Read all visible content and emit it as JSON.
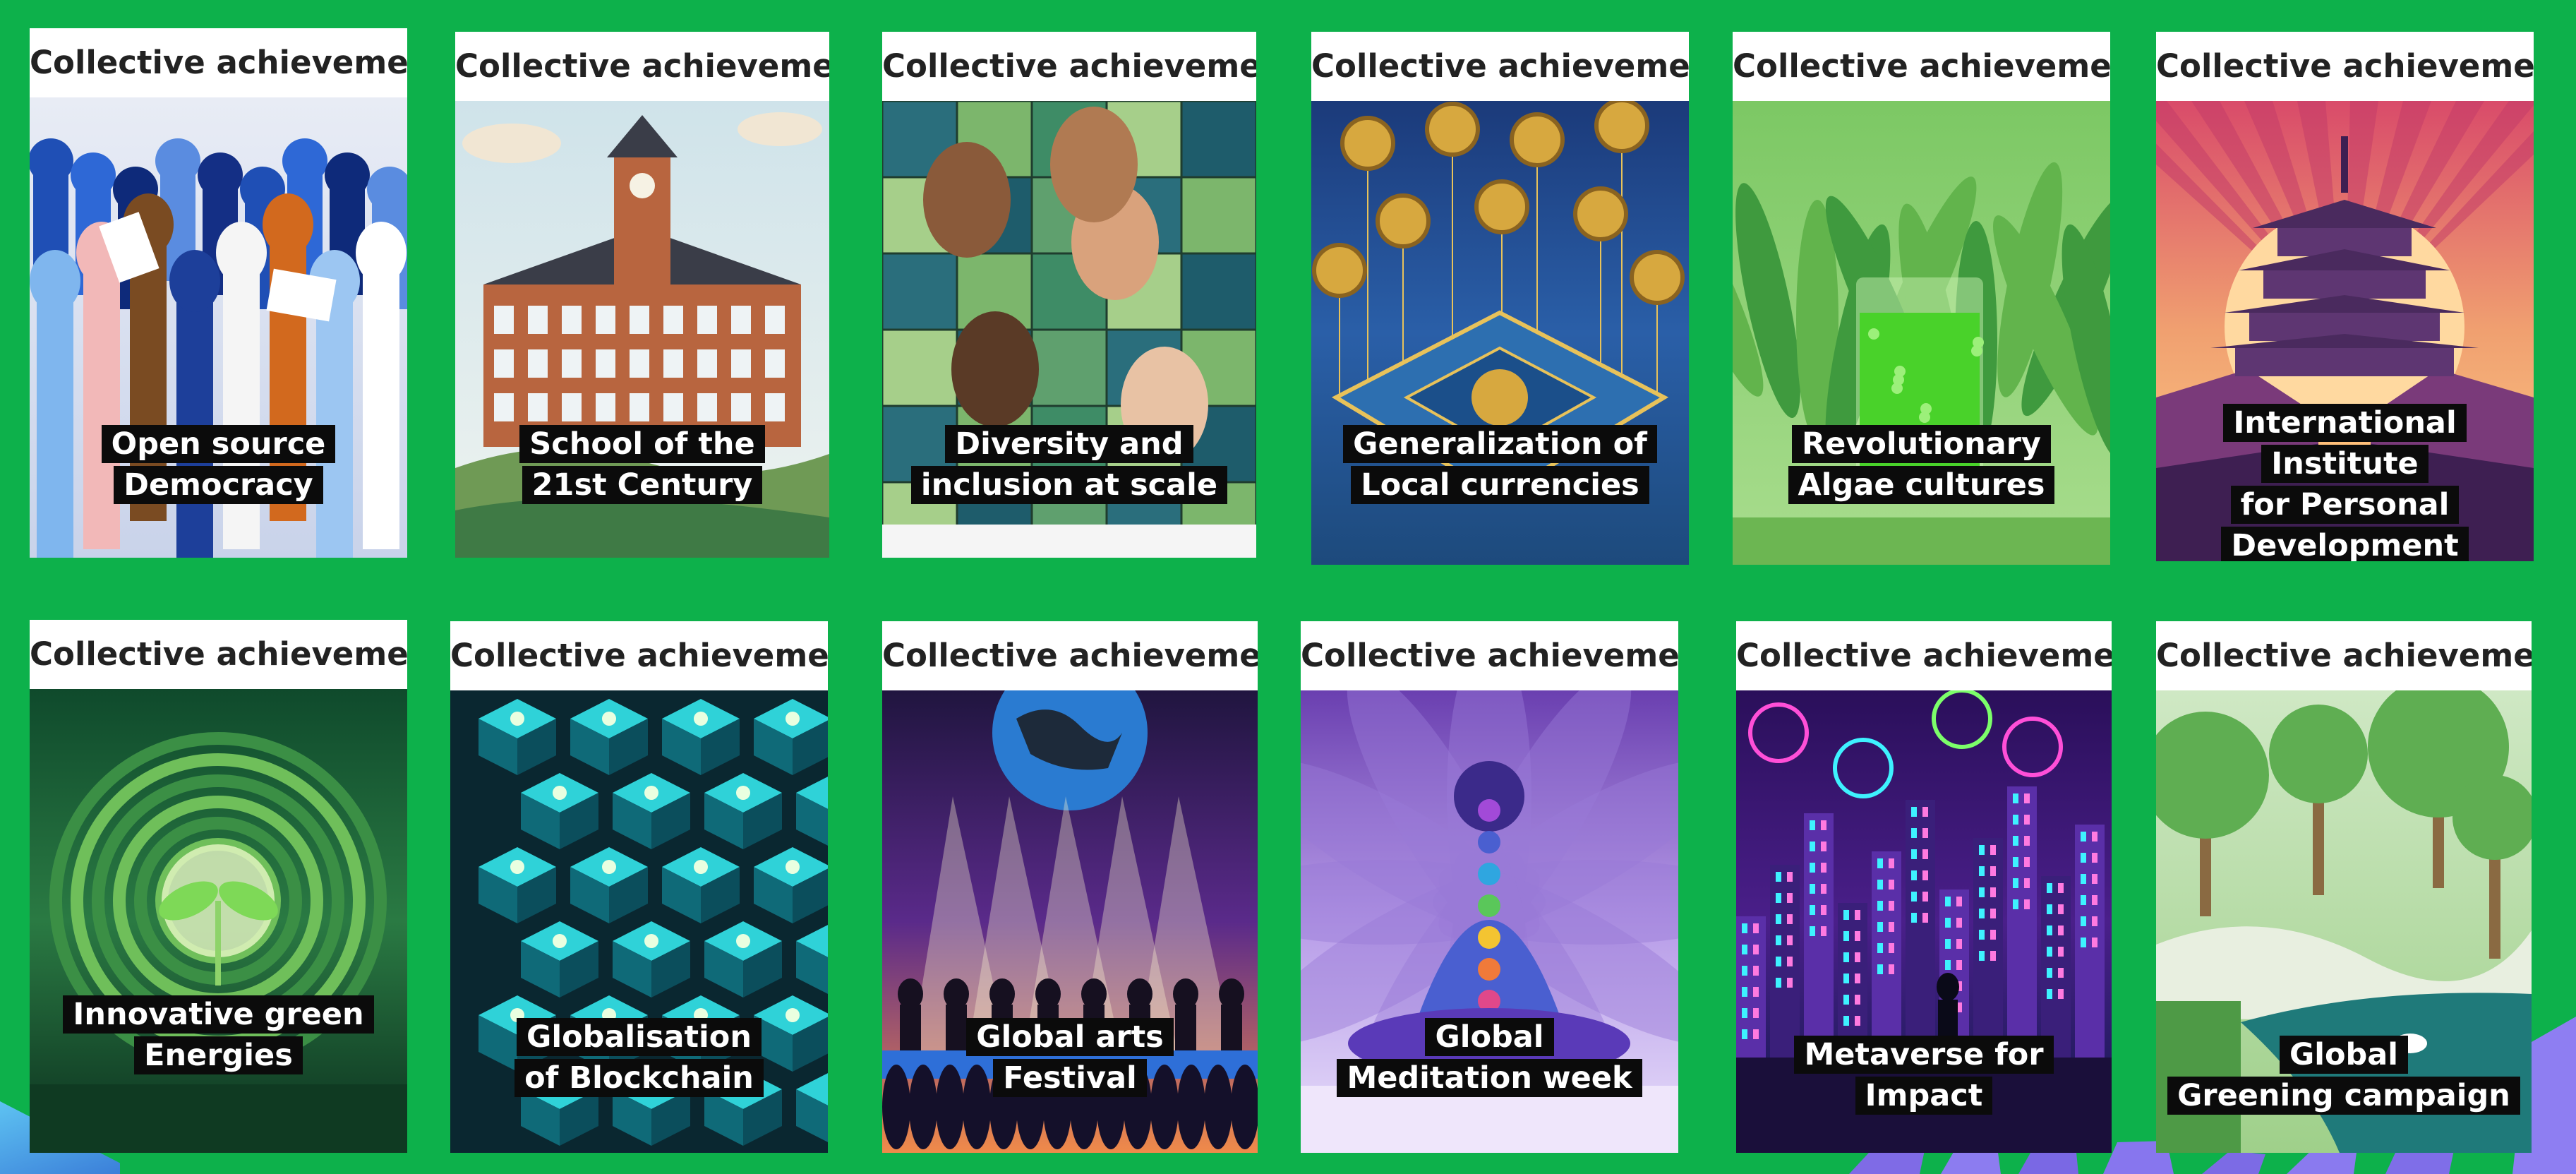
{
  "cards": [
    {
      "header": "Collective achievements",
      "caption": "Open source\nDemocracy",
      "art": "raised-hands-illustration"
    },
    {
      "header": "Collective achievements",
      "caption": "School of the\n21st Century",
      "art": "brick-school-building-illustration"
    },
    {
      "header": "Collective achievements",
      "caption": "Diversity and\ninclusion at scale",
      "art": "puzzle-faces-illustration"
    },
    {
      "header": "Collective achievements",
      "caption": "Generalization of\nLocal currencies",
      "art": "coin-circuit-chip-illustration"
    },
    {
      "header": "Collective achievements",
      "caption": "Revolutionary\nAlgae cultures",
      "art": "green-algae-glass-illustration"
    },
    {
      "header": "Collective achievements",
      "caption": "International Institute\nfor Personal\nDevelopment",
      "art": "pagoda-sunset-illustration"
    },
    {
      "header": "Collective achievements",
      "caption": "Innovative green\nEnergies",
      "art": "sprout-in-sphere-illustration"
    },
    {
      "header": "Collective achievements",
      "caption": "Globalisation\nof Blockchain",
      "art": "glowing-cube-network-illustration"
    },
    {
      "header": "Collective achievements",
      "caption": "Global arts\nFestival",
      "art": "concert-stage-globe-illustration"
    },
    {
      "header": "Collective achievements",
      "caption": "Global\nMeditation week",
      "art": "meditating-figure-chakras-illustration"
    },
    {
      "header": "Collective achievements",
      "caption": "Metaverse for\nImpact",
      "art": "neon-city-vr-illustration"
    },
    {
      "header": "Collective achievements",
      "caption": "Global\nGreening campaign",
      "art": "garden-river-illustration"
    }
  ],
  "colors": {
    "background": "#0db14b",
    "header_bg": "#ffffff",
    "caption_bg": "#0b0b0b",
    "caption_text": "#ffffff"
  }
}
